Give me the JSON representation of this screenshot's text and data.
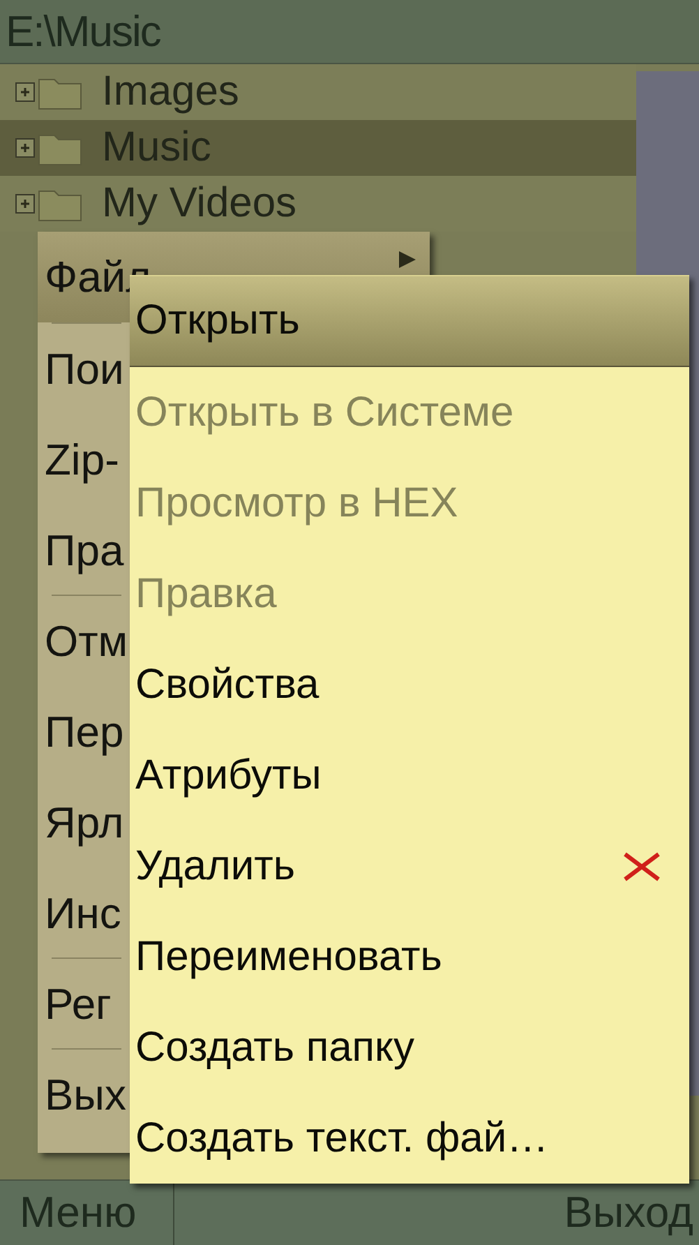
{
  "title": "E:\\Music",
  "tree": [
    {
      "label": "Images",
      "selected": false
    },
    {
      "label": "Music",
      "selected": true
    },
    {
      "label": "My Videos",
      "selected": false
    }
  ],
  "menu": [
    {
      "label": "Файл",
      "selected": true,
      "submenu": true,
      "divider_after": true
    },
    {
      "label": "Пои",
      "selected": false,
      "submenu": false,
      "divider_after": false
    },
    {
      "label": "Zip-",
      "selected": false,
      "submenu": false,
      "divider_after": false
    },
    {
      "label": "Пра",
      "selected": false,
      "submenu": false,
      "divider_after": true
    },
    {
      "label": "Отм",
      "selected": false,
      "submenu": false,
      "divider_after": false
    },
    {
      "label": "Пер",
      "selected": false,
      "submenu": false,
      "divider_after": false
    },
    {
      "label": "Ярл",
      "selected": false,
      "submenu": false,
      "divider_after": false
    },
    {
      "label": "Инс",
      "selected": false,
      "submenu": false,
      "divider_after": true
    },
    {
      "label": "Рег",
      "selected": false,
      "submenu": false,
      "divider_after": true
    },
    {
      "label": "Вых",
      "selected": false,
      "submenu": false,
      "divider_after": false
    }
  ],
  "submenu": [
    {
      "label": "Открыть",
      "selected": true,
      "disabled": false,
      "kind": "plain"
    },
    {
      "label": "Открыть в Системе",
      "selected": false,
      "disabled": true,
      "kind": "plain"
    },
    {
      "label": "Просмотр в HEX",
      "selected": false,
      "disabled": true,
      "kind": "plain"
    },
    {
      "label": "Правка",
      "selected": false,
      "disabled": true,
      "kind": "plain"
    },
    {
      "label": "Свойства",
      "selected": false,
      "disabled": false,
      "kind": "plain"
    },
    {
      "label": "Атрибуты",
      "selected": false,
      "disabled": false,
      "kind": "plain"
    },
    {
      "label": "Удалить",
      "selected": false,
      "disabled": false,
      "kind": "delete"
    },
    {
      "label": "Переименовать",
      "selected": false,
      "disabled": false,
      "kind": "plain"
    },
    {
      "label": "Создать папку",
      "selected": false,
      "disabled": false,
      "kind": "plain"
    },
    {
      "label": "Создать текст. фай…",
      "selected": false,
      "disabled": false,
      "kind": "plain"
    }
  ],
  "softkeys": {
    "left": "Меню",
    "right": "Выход"
  }
}
